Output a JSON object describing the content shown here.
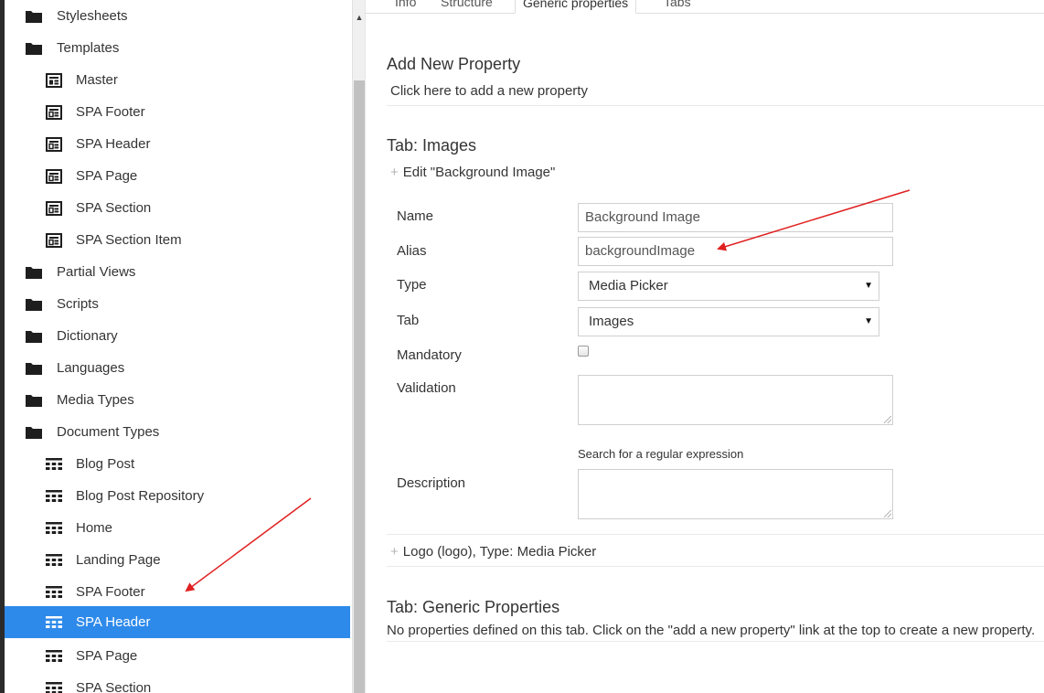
{
  "sidebar": {
    "items": [
      {
        "label": "Stylesheets",
        "icon": "folder-icon",
        "level": 1
      },
      {
        "label": "Templates",
        "icon": "folder-icon",
        "level": 1
      },
      {
        "label": "Master",
        "icon": "template-master-icon",
        "level": 2
      },
      {
        "label": "SPA Footer",
        "icon": "template-icon",
        "level": 2
      },
      {
        "label": "SPA Header",
        "icon": "template-icon",
        "level": 2
      },
      {
        "label": "SPA Page",
        "icon": "template-icon",
        "level": 2
      },
      {
        "label": "SPA Section",
        "icon": "template-icon",
        "level": 2
      },
      {
        "label": "SPA Section Item",
        "icon": "template-icon",
        "level": 2
      },
      {
        "label": "Partial Views",
        "icon": "folder-icon",
        "level": 1
      },
      {
        "label": "Scripts",
        "icon": "folder-icon",
        "level": 1
      },
      {
        "label": "Dictionary",
        "icon": "folder-icon",
        "level": 1
      },
      {
        "label": "Languages",
        "icon": "folder-icon",
        "level": 1
      },
      {
        "label": "Media Types",
        "icon": "folder-icon",
        "level": 1
      },
      {
        "label": "Document Types",
        "icon": "folder-icon",
        "level": 1
      },
      {
        "label": "Blog Post",
        "icon": "doctype-grid-icon",
        "level": 2
      },
      {
        "label": "Blog Post Repository",
        "icon": "doctype-grid-icon",
        "level": 2
      },
      {
        "label": "Home",
        "icon": "doctype-grid-icon",
        "level": 2
      },
      {
        "label": "Landing Page",
        "icon": "doctype-grid-icon",
        "level": 2
      },
      {
        "label": "SPA Footer",
        "icon": "doctype-grid-icon",
        "level": 2
      },
      {
        "label": "SPA Header",
        "icon": "doctype-grid-icon",
        "level": 2,
        "selected": true
      },
      {
        "label": "SPA Page",
        "icon": "doctype-grid-icon",
        "level": 2
      },
      {
        "label": "SPA Section",
        "icon": "doctype-grid-icon",
        "level": 2
      }
    ]
  },
  "tabs": [
    "Info",
    "Structure",
    "Generic properties",
    "Tabs"
  ],
  "active_tab": "Generic properties",
  "add_property": {
    "title": "Add New Property",
    "link": "Click here to add a new property"
  },
  "images_tab": {
    "title": "Tab: Images",
    "edit_label": "Edit \"Background Image\"",
    "form": {
      "name_label": "Name",
      "name_value": "Background Image",
      "alias_label": "Alias",
      "alias_value": "backgroundImage",
      "type_label": "Type",
      "type_value": "Media Picker",
      "tab_label": "Tab",
      "tab_value": "Images",
      "mandatory_label": "Mandatory",
      "validation_label": "Validation",
      "regex_hint": "Search for a regular expression",
      "description_label": "Description"
    },
    "logo_item": "Logo (logo), Type: Media Picker"
  },
  "generic_tab": {
    "title": "Tab: Generic Properties",
    "empty_text": "No properties defined on this tab. Click on the \"add a new property\" link at the top to create a new property."
  },
  "colors": {
    "selected_row": "#2e8aea",
    "annotation_arrow": "#e02020"
  }
}
